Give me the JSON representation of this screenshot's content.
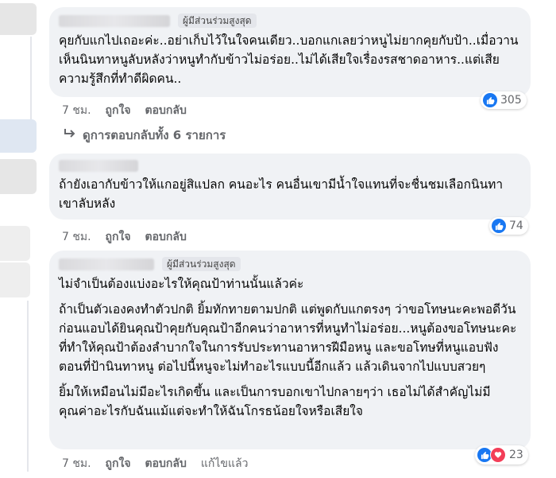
{
  "comments": [
    {
      "badge": "ผู้มีส่วนร่วมสูงสุด",
      "paragraphs": [
        "คุยกับแกไปเถอะค่ะ..อย่าเก็บไว้ในใจคนเดียว..บอกแกเลยว่าหนูไม่ยากคุยกับป้า..เมื่อวานเห็นนินทาหนูลับหลังว่าหนูทำกับข้าวไม่อร่อย..ไม่ได้เสียใจเรื่องรสชาดอาหาร..แต่เสียความรู้สึกที่ทำดีผิดคน.."
      ],
      "time": "7 ชม.",
      "like": "ถูกใจ",
      "reply": "ตอบกลับ",
      "reaction_count": "305",
      "view_replies": "ดูการตอบกลับทั้ง 6 รายการ"
    },
    {
      "paragraphs": [
        "ถ้ายังเอากับข้าวให้แกอยู่สิแปลก คนอะไร คนอื่นเขามีน้ำใจแทนที่จะชื่นชมเลือกนินทาเขาลับหลัง"
      ],
      "time": "7 ชม.",
      "like": "ถูกใจ",
      "reply": "ตอบกลับ",
      "reaction_count": "74"
    },
    {
      "badge": "ผู้มีส่วนร่วมสูงสุด",
      "paragraphs": [
        "ไม่จำเป็นต้องแบ่งอะไรให้คุณป้าท่านนั้นแล้วค่ะ",
        "ถ้าเป็นตัวเองคงทำตัวปกติ ยิ้มทักทายตามปกติ แต่พูดกับแกตรงๆ ว่าขอโทษนะคะพอดีวันก่อนแอบได้ยินคุณป้าคุยกับคุณป้าอีกคนว่าอาหารที่หนูทำไม่อร่อย...หนูต้องขอโทษนะคะที่ทำให้คุณป้าต้องลำบากใจในการรับประทานอาหารฝีมือหนู และขอโทษที่หนูแอบฟังตอนที่ป้านินทาหนู ต่อไปนี้หนูจะไม่ทำอะไรแบบนี้อีกแล้ว แล้วเดินจากไปแบบสวยๆ",
        "ยิ้มให้เหมือนไม่มีอะไรเกิดขึ้น และเป็นการบอกเขาไปกลายๆว่า เธอไม่ได้สำคัญไม่มีคุณค่าอะไรกับฉันแม้แต่จะทำให้ฉันโกรธน้อยใจหรือเสียใจ"
      ],
      "time": "7 ชม.",
      "like": "ถูกใจ",
      "reply": "ตอบกลับ",
      "edited": "แก้ไขแล้ว",
      "reaction_count": "23"
    }
  ],
  "colors": {
    "bubble": "#f0f2f5",
    "like_blue": "#1877f2",
    "love_red": "#f33e58",
    "meta_gray": "#65676b"
  }
}
